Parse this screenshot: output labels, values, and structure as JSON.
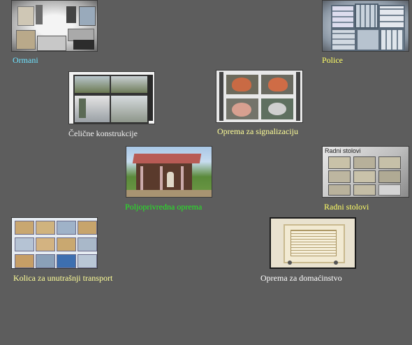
{
  "items": [
    {
      "label": "Ormani",
      "color": "#6fe3ff",
      "image": "cabinets-photo"
    },
    {
      "label": "Police",
      "color": "#ffff66",
      "image": "shelves-photo"
    },
    {
      "label": "Čelične konstrukcije",
      "color": "#f0f0f0",
      "image": "steel-constructions-photo"
    },
    {
      "label": "Oprema za signalizaciju",
      "color": "#ffff99",
      "image": "signalization-equipment-photo"
    },
    {
      "label": "Poljoprivredna oprema",
      "color": "#22ee22",
      "image": "agricultural-equipment-photo"
    },
    {
      "label": "Radni stolovi",
      "color": "#ffff66",
      "image": "workbenches-photo",
      "caption": "Radni stolovi"
    },
    {
      "label": "Kolica za unutrašnji transport",
      "color": "#ffff99",
      "image": "transport-carts-photo"
    },
    {
      "label": "Oprema za domaćinstvo",
      "color": "#ffffff",
      "image": "household-equipment-photo"
    }
  ]
}
